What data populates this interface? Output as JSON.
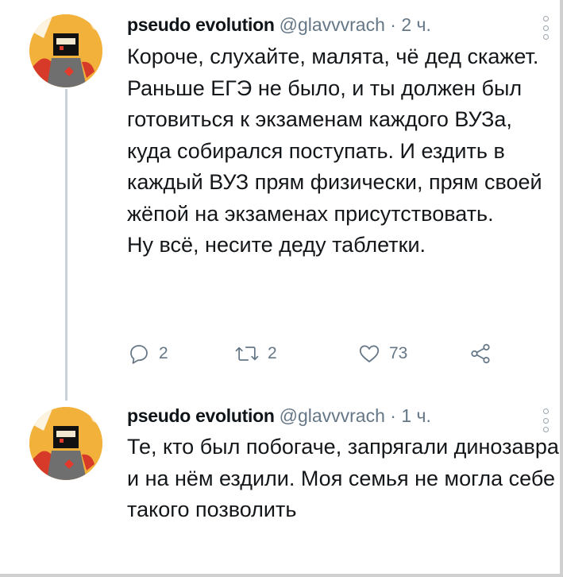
{
  "tweets": [
    {
      "author_name": "pseudo evolution",
      "handle": "@glavvvrach",
      "separator": "·",
      "time": "2 ч.",
      "paragraphs": [
        "Короче, слухайте, малята, чё дед скажет.",
        "Раньше ЕГЭ не было, и ты должен был готовиться к экзаменам каждого ВУЗа, куда собирался поступать. И ездить в каждый ВУЗ прям физически, прям своей жёпой на экзаменах присутствовать.",
        "Ну всё, несите деду таблетки."
      ],
      "replies": "2",
      "retweets": "2",
      "likes": "73"
    },
    {
      "author_name": "pseudo evolution",
      "handle": "@glavvvrach",
      "separator": "·",
      "time": "1 ч.",
      "paragraphs": [
        "Те, кто был побогаче, запрягали динозавра и на нём ездили. Моя семья не могла себе такого позволить"
      ]
    }
  ],
  "colors": {
    "muted": "#657786",
    "text": "#14171a",
    "thread_line": "#c9d2d9",
    "avatar_bg": "#f2b13a"
  },
  "icons": [
    "reply-icon",
    "retweet-icon",
    "like-icon",
    "share-icon",
    "more-icon"
  ]
}
